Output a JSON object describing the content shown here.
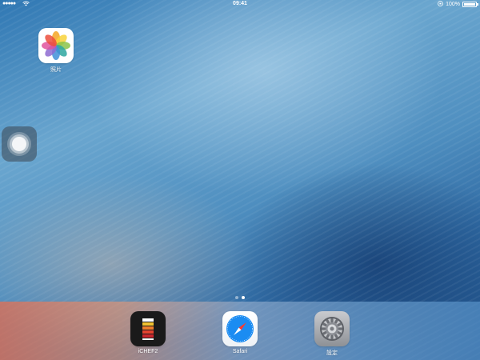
{
  "status_bar": {
    "signal": "●●●●●",
    "time": "09:41",
    "battery_percent": "100%",
    "battery_level": 1.0
  },
  "home_apps": [
    {
      "label": "照片",
      "icon": "photos-icon"
    }
  ],
  "page_indicator": {
    "count": 2,
    "active_index": 1
  },
  "dock": {
    "apps": [
      {
        "label": "iCHEF2",
        "icon": "ichef-icon"
      },
      {
        "label": "Safari",
        "icon": "safari-icon"
      },
      {
        "label": "設定",
        "icon": "settings-icon"
      }
    ]
  },
  "colors": {
    "ichef_background": "#1a1a1a",
    "safari_blue": "#1b8cf2",
    "settings_gray": "#8e9196"
  }
}
